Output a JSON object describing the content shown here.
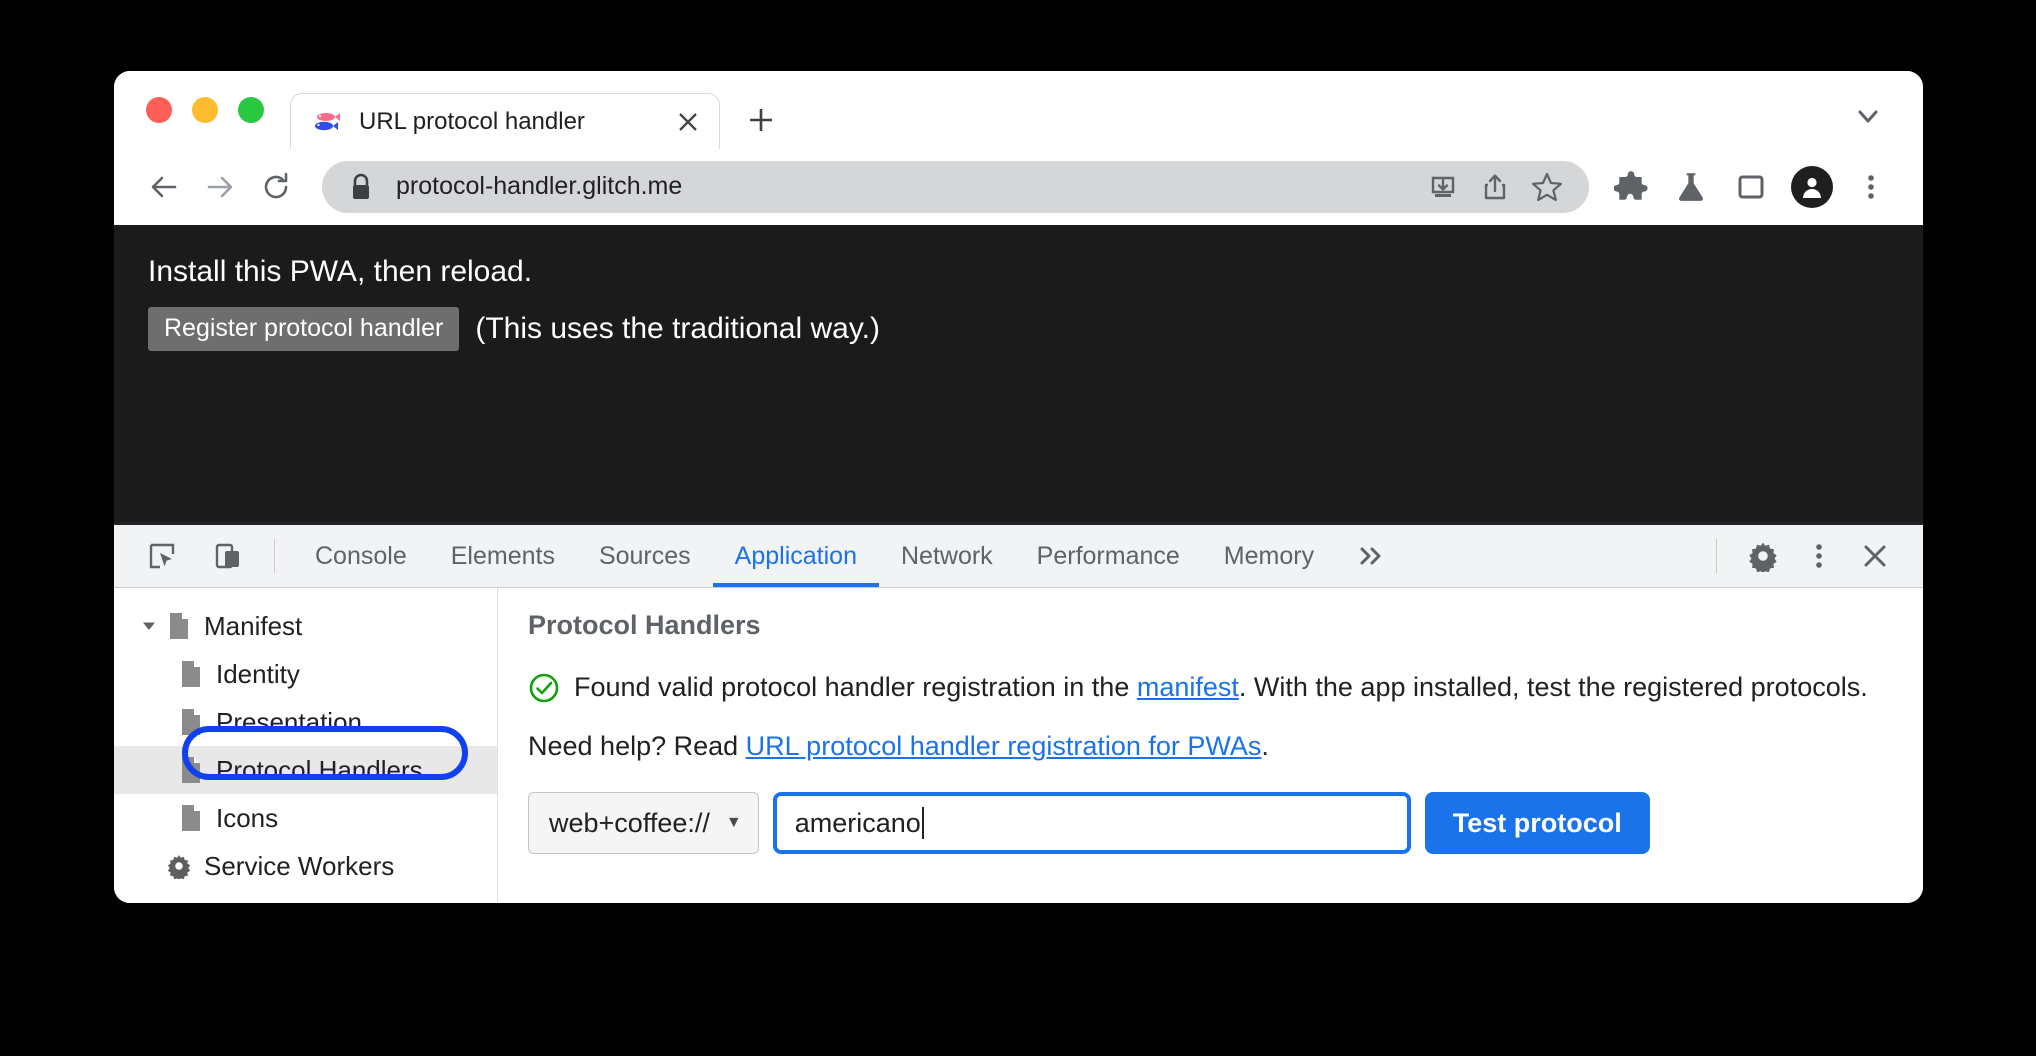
{
  "window": {
    "traffic_lights": [
      "close",
      "minimize",
      "maximize"
    ]
  },
  "tabstrip": {
    "tab": {
      "favicon": "fish-favicon",
      "title": "URL protocol handler",
      "close_label": "×"
    },
    "new_tab_label": "+",
    "chevron_label": "chevron-down"
  },
  "toolbar": {
    "back_icon": "back-arrow-icon",
    "forward_icon": "forward-arrow-icon",
    "reload_icon": "reload-icon",
    "lock_icon": "lock-icon",
    "url": "protocol-handler.glitch.me",
    "actions": [
      "install-pwa-icon",
      "share-icon",
      "bookmark-star-icon",
      "extensions-puzzle-icon",
      "experiments-flask-icon",
      "side-panel-icon"
    ],
    "avatar_icon": "profile-avatar-icon",
    "menu_icon": "three-dot-menu-icon"
  },
  "page": {
    "heading": "Install this PWA, then reload.",
    "register_button": "Register protocol handler",
    "note": "(This uses the traditional way.)"
  },
  "devtools": {
    "inspect_icon": "inspect-element-icon",
    "device_icon": "device-toolbar-icon",
    "tabs": [
      {
        "label": "Console",
        "active": false
      },
      {
        "label": "Elements",
        "active": false
      },
      {
        "label": "Sources",
        "active": false
      },
      {
        "label": "Application",
        "active": true
      },
      {
        "label": "Network",
        "active": false
      },
      {
        "label": "Performance",
        "active": false
      },
      {
        "label": "Memory",
        "active": false
      }
    ],
    "more_tabs_label": "»",
    "settings_icon": "gear-icon",
    "more_icon": "three-dot-menu-icon",
    "close_icon": "close-icon",
    "sidebar": {
      "items": [
        {
          "label": "Manifest",
          "icon": "document-icon",
          "level": 0,
          "expanded": true,
          "selected": false
        },
        {
          "label": "Identity",
          "icon": "document-icon",
          "level": 1,
          "selected": false
        },
        {
          "label": "Presentation",
          "icon": "document-icon",
          "level": 1,
          "selected": false
        },
        {
          "label": "Protocol Handlers",
          "icon": "document-icon",
          "level": 1,
          "selected": true
        },
        {
          "label": "Icons",
          "icon": "document-icon",
          "level": 1,
          "selected": false
        },
        {
          "label": "Service Workers",
          "icon": "gear-icon",
          "level": 0,
          "selected": false
        }
      ]
    },
    "panel": {
      "title": "Protocol Handlers",
      "status_icon": "check-circle-icon",
      "status_text_1": "Found valid protocol handler registration in the ",
      "status_link": "manifest",
      "status_text_2": ". With the app installed, test the registered protocols.",
      "help_text": "Need help? Read ",
      "help_link": "URL protocol handler registration for PWAs",
      "help_suffix": ".",
      "select_value": "web+coffee://",
      "select_caret": "▼",
      "input_value": "americano",
      "input_placeholder": "",
      "test_button": "Test protocol"
    }
  },
  "colors": {
    "accent_blue": "#1a73e8",
    "highlight_blue": "#1141ef",
    "success_green": "#13a10e",
    "page_dark": "#1b1b1b",
    "devtools_bg": "#f1f3f4"
  }
}
